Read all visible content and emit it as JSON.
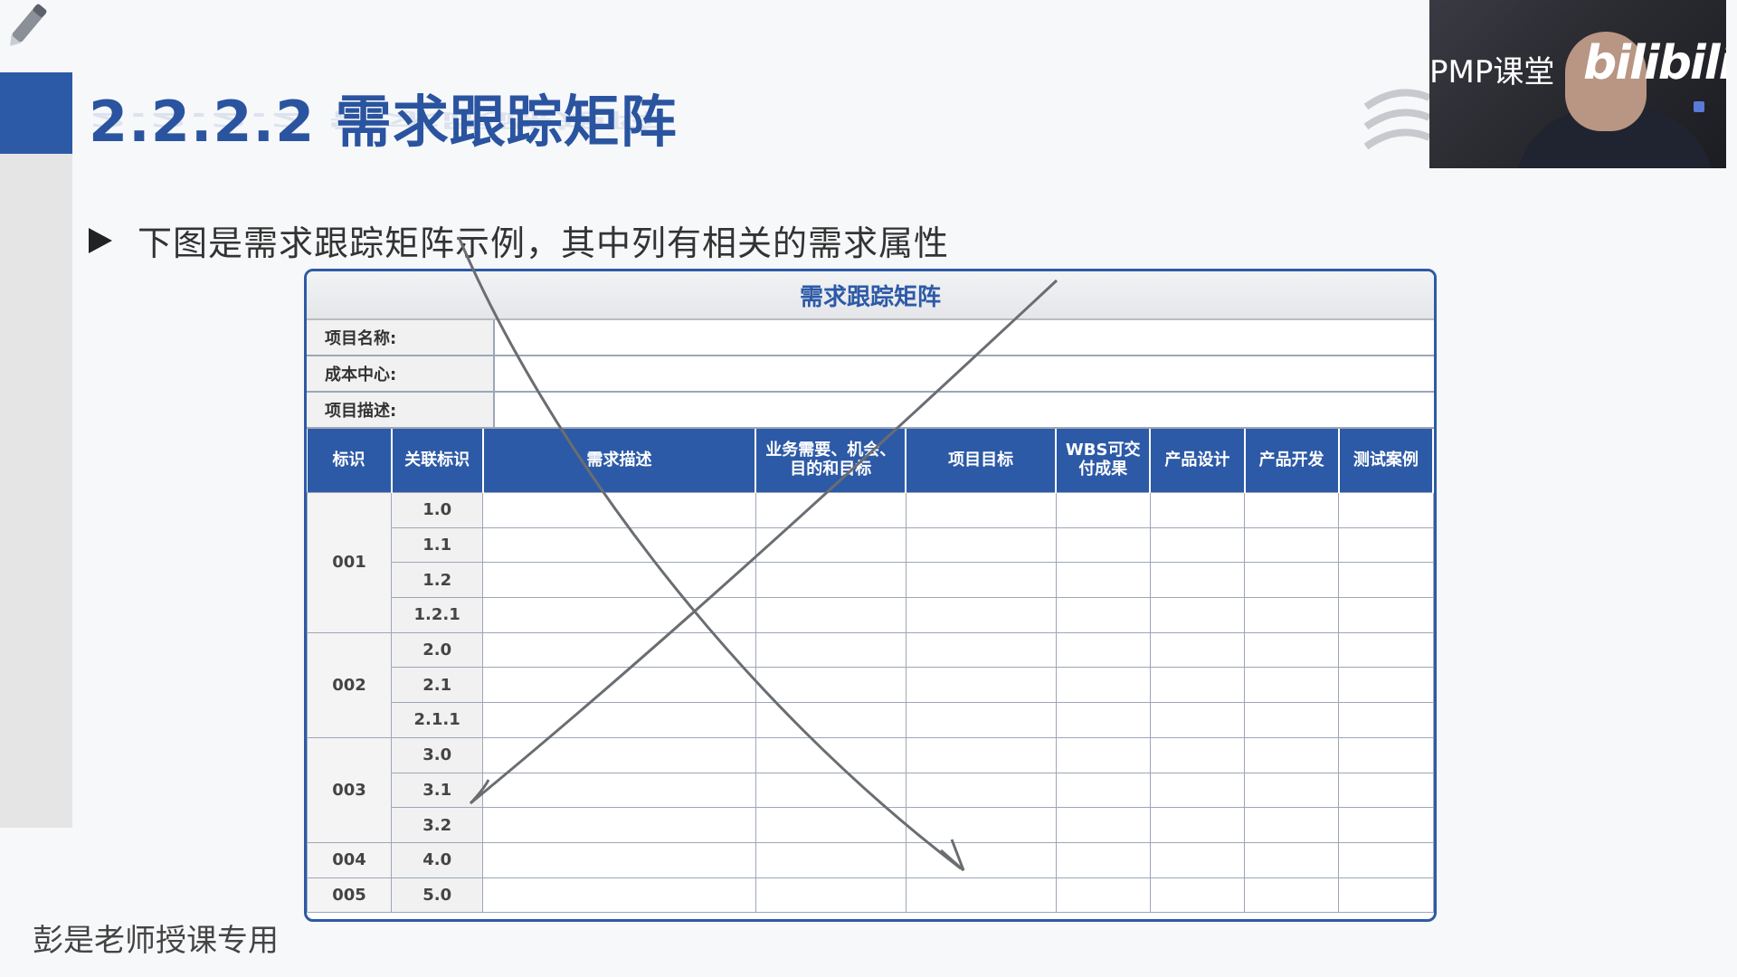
{
  "slide": {
    "title": "2.2.2.2 需求跟踪矩阵",
    "bullet": "下图是需求跟踪矩阵示例，其中列有相关的需求属性",
    "watermark": "彭是老师授课专用",
    "accent_color": "#2d5aa6"
  },
  "video_overlay": {
    "label": "PMP课堂",
    "logo_text": "bilibili"
  },
  "matrix": {
    "title": "需求跟踪矩阵",
    "info_labels": [
      "项目名称:",
      "成本中心:",
      "项目描述:"
    ],
    "columns": [
      "标识",
      "关联标识",
      "需求描述",
      "业务需要、机会、目的和目标",
      "项目目标",
      "WBS可交付成果",
      "产品设计",
      "产品开发",
      "测试案例"
    ],
    "groups": [
      {
        "id": "001",
        "refs": [
          "1.0",
          "1.1",
          "1.2",
          "1.2.1"
        ]
      },
      {
        "id": "002",
        "refs": [
          "2.0",
          "2.1",
          "2.1.1"
        ]
      },
      {
        "id": "003",
        "refs": [
          "3.0",
          "3.1",
          "3.2"
        ]
      },
      {
        "id": "004",
        "refs": [
          "4.0"
        ]
      },
      {
        "id": "005",
        "refs": [
          "5.0"
        ]
      }
    ]
  },
  "icons": {
    "pen": "pen-icon",
    "bullet": "play-triangle-icon",
    "logo": "wave-logo-icon"
  }
}
